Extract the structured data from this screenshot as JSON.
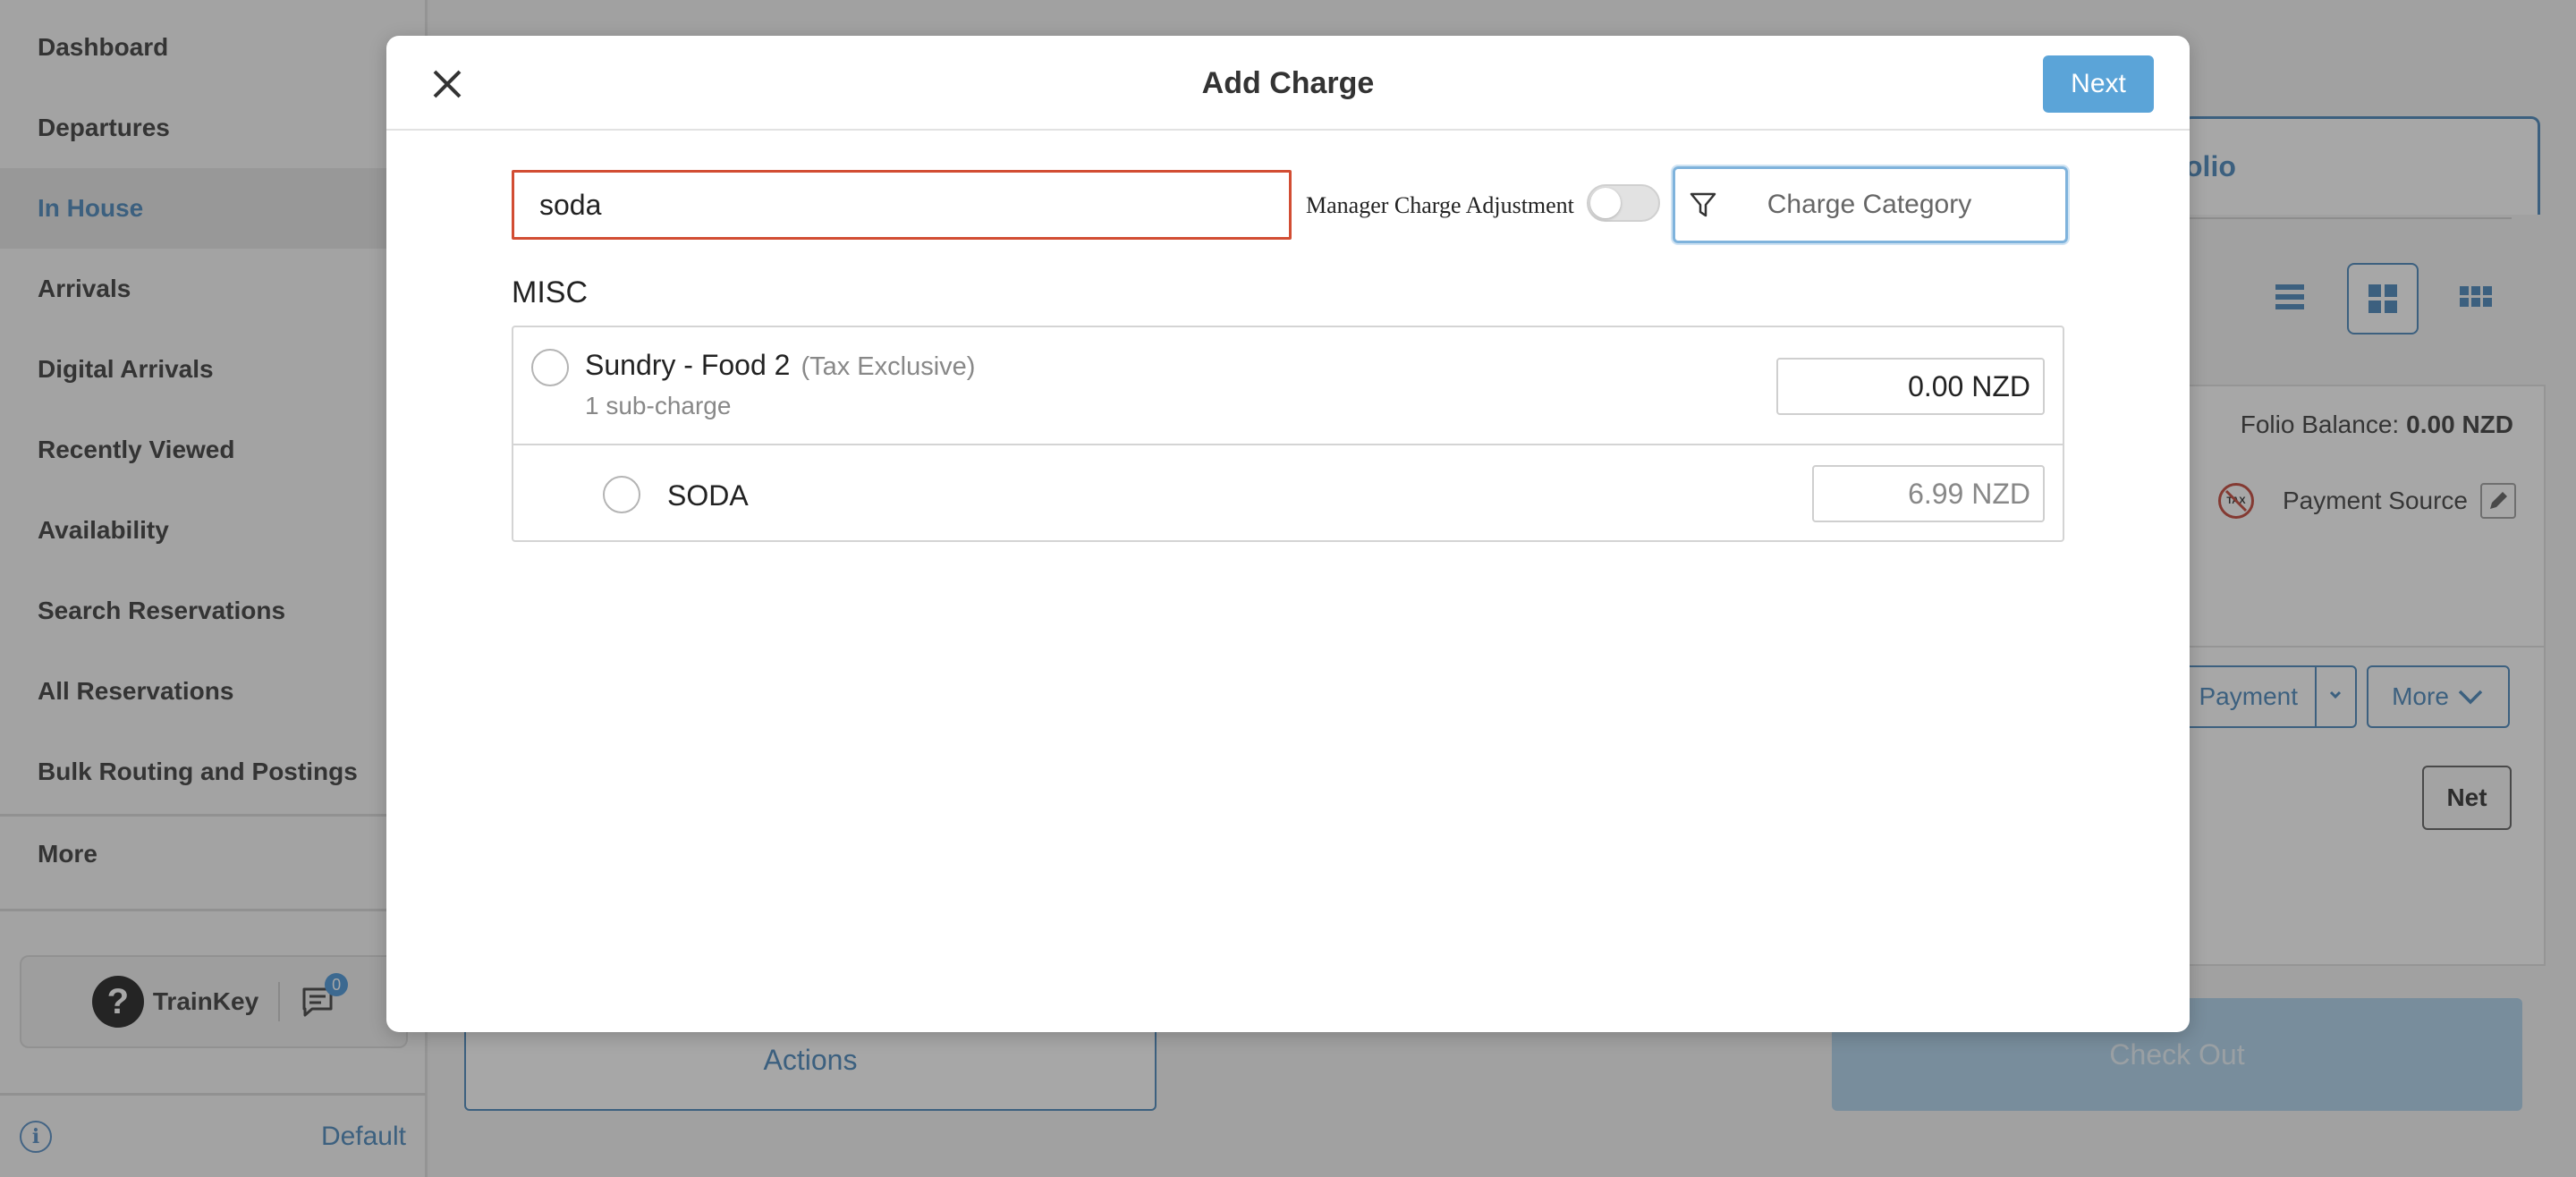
{
  "sidebar": {
    "items": [
      {
        "label": "Dashboard"
      },
      {
        "label": "Departures"
      },
      {
        "label": "In House"
      },
      {
        "label": "Arrivals"
      },
      {
        "label": "Digital Arrivals"
      },
      {
        "label": "Recently Viewed"
      },
      {
        "label": "Availability"
      },
      {
        "label": "Search Reservations"
      },
      {
        "label": "All Reservations"
      },
      {
        "label": "Bulk Routing and Postings"
      },
      {
        "label": "More"
      }
    ],
    "active_item": "In House",
    "trainkey_label": "TrainKey",
    "help_glyph": "?",
    "chat_badge_count": "0",
    "info_glyph": "i",
    "footer_link": "Default"
  },
  "main": {
    "folio_tab_label": "olio",
    "folio_balance_label": "Folio Balance:",
    "folio_balance_value": "0.00 NZD",
    "tax_icon_text": "TAX",
    "payment_source_label": "Payment Source",
    "payment_button_label": "Payment",
    "more_button_label": "More",
    "net_button_label": "Net",
    "actions_button_label": "Actions",
    "checkout_button_label": "Check Out"
  },
  "modal": {
    "title": "Add Charge",
    "next_label": "Next",
    "search_value": "soda",
    "manager_adjustment_label": "Manager Charge Adjustment",
    "manager_adjustment_on": false,
    "category_placeholder": "Charge Category",
    "group_label": "MISC",
    "charge": {
      "name": "Sundry - Food 2",
      "tax_note": "(Tax Exclusive)",
      "sub_count": "1 sub-charge",
      "amount": "0.00 NZD"
    },
    "sub_charge": {
      "name": "SODA",
      "amount": "6.99 NZD"
    }
  },
  "colors": {
    "accent": "#3c7fb6",
    "next_button": "#5ba4d8",
    "search_border": "#d24d33",
    "checkout_disabled": "#a9d0ec"
  }
}
